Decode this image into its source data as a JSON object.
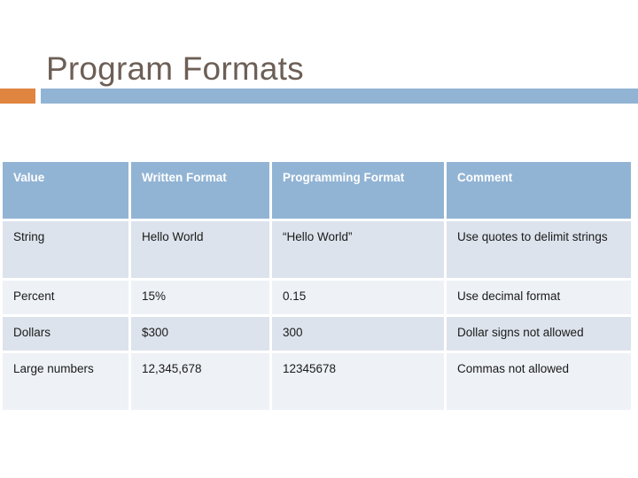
{
  "slide": {
    "title": "Program Formats",
    "accent_orange": "#e0853f",
    "accent_blue": "#92b4d4",
    "title_color": "#6d5f56"
  },
  "table": {
    "headers": [
      "Value",
      "Written Format",
      "Programming Format",
      "Comment"
    ],
    "rows": [
      {
        "value": "String",
        "written": "Hello World",
        "programming": "“Hello World”",
        "comment": "Use quotes to delimit strings"
      },
      {
        "value": "Percent",
        "written": "15%",
        "programming": "0.15",
        "comment": "Use decimal format"
      },
      {
        "value": "Dollars",
        "written": "$300",
        "programming": "300",
        "comment": "Dollar signs not allowed"
      },
      {
        "value": "Large numbers",
        "written": "12,345,678",
        "programming": "12345678",
        "comment": "Commas not allowed"
      }
    ],
    "header_bg": "#92b4d4",
    "row_dark_bg": "#dce3ec",
    "row_light_bg": "#eef1f6"
  }
}
